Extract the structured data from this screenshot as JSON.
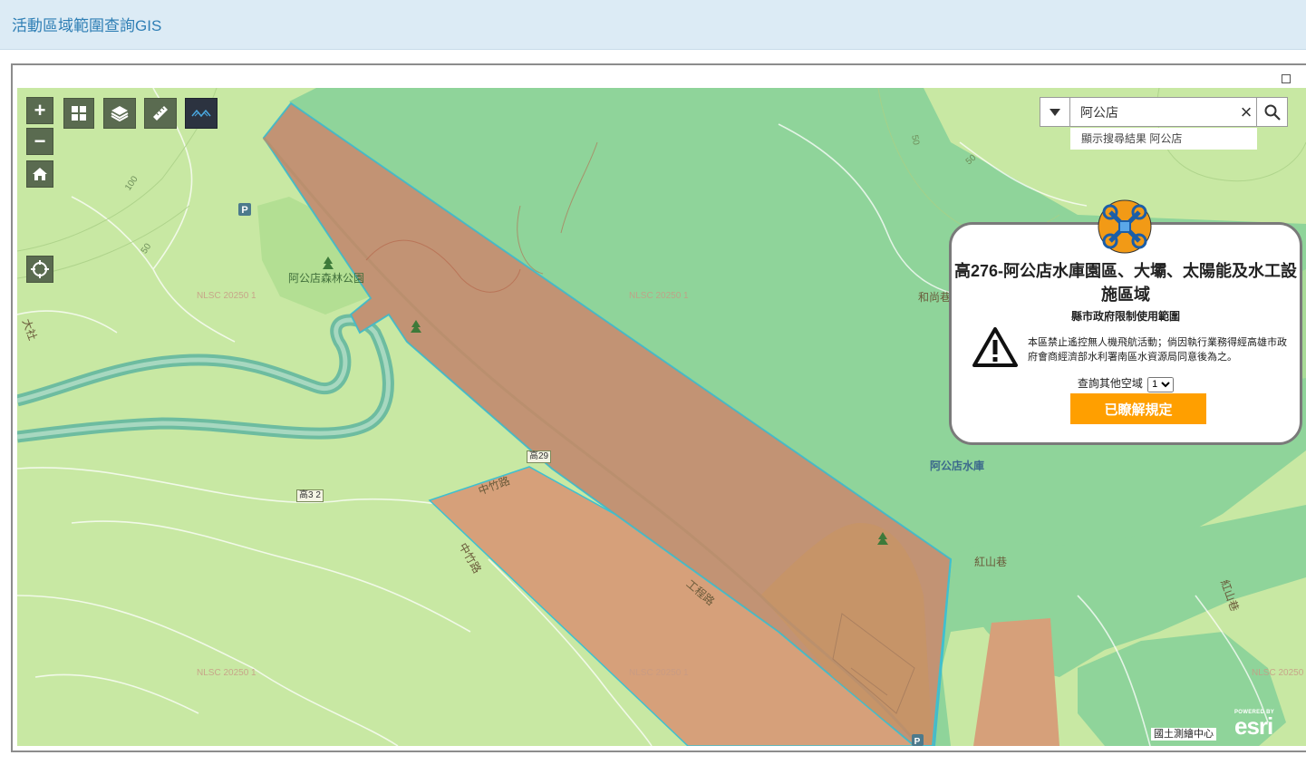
{
  "app": {
    "title": "活動區域範圍查詢GIS"
  },
  "map_controls": {
    "zoom_in": "+",
    "zoom_out": "−"
  },
  "search": {
    "value": "阿公店",
    "suggestion": "顯示搜尋結果 阿公店"
  },
  "map_labels": {
    "park": "阿公店森林公園",
    "reservoir": "阿公店水庫",
    "hongshan_lane": "紅山巷",
    "hongshan_lane_vertical": "紅山巷",
    "heshang_lane": "和尚巷",
    "zhongzhu_road_1": "中竹路",
    "zhongzhu_road_2": "中竹路",
    "gongcheng_road": "工程路",
    "datai_road": "大社",
    "watermark": "NLSC 20250 1",
    "shield_kao29": "高29",
    "shield_kao32": "高3 2",
    "contour_100": "100",
    "contour_50a": "50",
    "contour_50b": "50",
    "contour_50c": "50"
  },
  "popup": {
    "title": "高276-阿公店水庫園區、大壩、太陽能及水工設施區域",
    "subtitle": "縣市政府限制使用範圍",
    "notice": "本區禁止遙控無人機飛航活動；倘因執行業務得經高雄市政府會商經濟部水利署南區水資源局同意後為之。",
    "query_label": "查詢其他空域",
    "query_selected": "1",
    "button": "已瞭解規定"
  },
  "attribution": "國土測繪中心",
  "esri": {
    "powered_by": "POWERED BY",
    "name": "esri"
  },
  "colors": {
    "base_land": "#c8e8a3",
    "water_zone": "#8fd49a",
    "restricted_zone": "#d6a07a",
    "zone_outline": "#3ec0d0",
    "accent_button": "#ff9f00",
    "title_text": "#2f7fb5"
  }
}
